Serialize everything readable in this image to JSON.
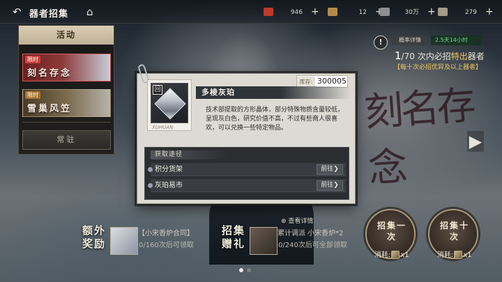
{
  "header": {
    "title": "器者招集",
    "resources": [
      {
        "icon": "envelope-icon",
        "value": "946",
        "color": "#c0392b"
      },
      {
        "icon": "gem-icon",
        "value": "12",
        "color": "#b58b4a"
      },
      {
        "icon": "ticket-icon",
        "value": "30万",
        "color": "#8d8f95"
      },
      {
        "icon": "token-icon",
        "value": "279",
        "color": "#a59a86"
      }
    ]
  },
  "sidebar": {
    "heading": "活动",
    "banners": [
      {
        "tag": "限时",
        "name": "刻名存念"
      },
      {
        "tag": "限时",
        "name": "雪巢风笠"
      }
    ],
    "normal_label": "常驻"
  },
  "summon_info": {
    "prob_button": "概率详情",
    "timer": "2.5天14小时",
    "guarantee_count": "1",
    "guarantee_total": "/70",
    "guarantee_text_a": "次内必招",
    "guarantee_highlight": "特出",
    "guarantee_text_b": "器者",
    "guarantee_note": "【每十次必招优异及以上器者】",
    "background_calligraphy": "刻名存念"
  },
  "bonus": {
    "title": "额外奖励",
    "name": "【小宋香炉合同】",
    "progress": "0/160次后可领取"
  },
  "gift": {
    "title": "招集赠礼",
    "detail_link": "查看详情",
    "name": "累计调派 小宋香炉*2",
    "progress": "0/240次后可全部领取"
  },
  "summon_buttons": [
    {
      "label": "招集一次",
      "cost_prefix": "消耗:",
      "cost": "x1"
    },
    {
      "label": "招集十次",
      "cost_prefix": "消耗:",
      "cost": "x1"
    }
  ],
  "item_modal": {
    "name": "多棱灰珀",
    "stock_label": "库存:",
    "stock_value": "300005",
    "badge": "回",
    "signature": "XUHUAN",
    "description": "技术部提取的方形晶体，部分特殊物质含量较低，呈现灰白色，研究价值不高，不过有些商人很喜欢，可以兑换一些特定物品。",
    "source_title": "获取途径",
    "sources": [
      {
        "name": "积分货架",
        "action": "前往"
      },
      {
        "name": "灰珀易市",
        "action": "前往"
      }
    ]
  },
  "colors": {
    "accent_gold": "#f0c660",
    "timer_green": "#6fdc8c",
    "limited_tag": "#c9403a"
  }
}
